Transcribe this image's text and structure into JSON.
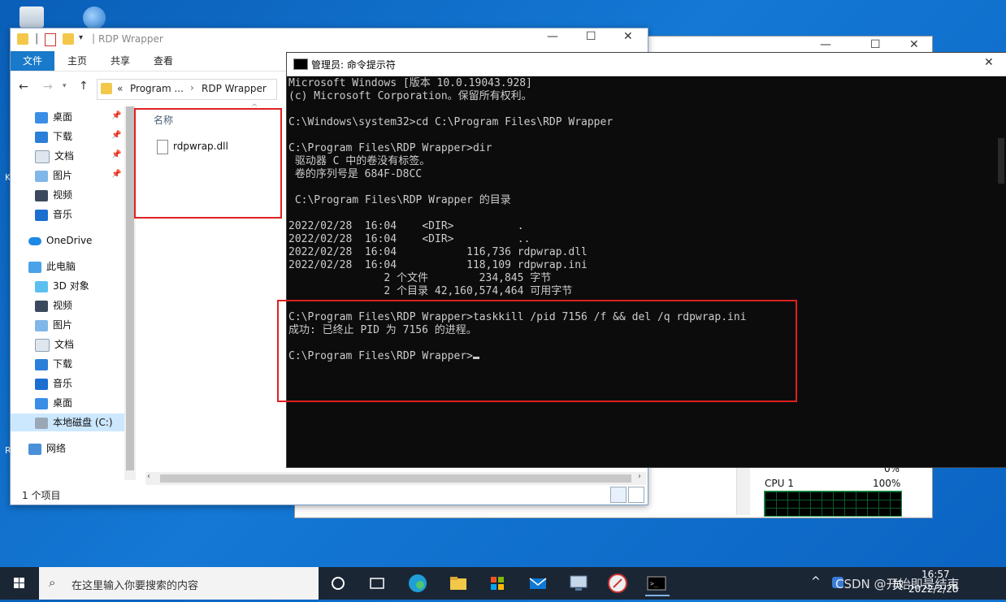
{
  "desktop": {
    "icons": [
      {
        "name": "recycle-bin"
      },
      {
        "name": "network-globe"
      }
    ],
    "side_letters": [
      "K",
      "R"
    ]
  },
  "explorer": {
    "title": "RDP Wrapper",
    "ribbon_tabs": [
      "文件",
      "主页",
      "共享",
      "查看"
    ],
    "breadcrumb": {
      "prefix": "«",
      "items": [
        "Program ...",
        "RDP Wrapper"
      ]
    },
    "nav_quick": [
      {
        "label": "桌面",
        "icon": "desktop-icon"
      },
      {
        "label": "下载",
        "icon": "download-icon"
      },
      {
        "label": "文档",
        "icon": "documents-icon"
      },
      {
        "label": "图片",
        "icon": "pictures-icon"
      },
      {
        "label": "视频",
        "icon": "video-icon"
      },
      {
        "label": "音乐",
        "icon": "music-icon"
      }
    ],
    "onedrive": "OneDrive",
    "this_pc": "此电脑",
    "nav_pc": [
      {
        "label": "3D 对象",
        "icon": "3d-objects-icon"
      },
      {
        "label": "视频",
        "icon": "video-icon"
      },
      {
        "label": "图片",
        "icon": "pictures-icon"
      },
      {
        "label": "文档",
        "icon": "documents-icon"
      },
      {
        "label": "下载",
        "icon": "download-icon"
      },
      {
        "label": "音乐",
        "icon": "music-icon"
      },
      {
        "label": "桌面",
        "icon": "desktop-icon"
      },
      {
        "label": "本地磁盘 (C:)",
        "icon": "local-disk-icon"
      }
    ],
    "network": "网络",
    "column_header": "名称",
    "files": [
      "rdpwrap.dll"
    ],
    "status": "1 个项目"
  },
  "cmd": {
    "title": "管理员: 命令提示符",
    "lines": [
      "Microsoft Windows [版本 10.0.19043.928]",
      "(c) Microsoft Corporation。保留所有权利。",
      "",
      "C:\\Windows\\system32>cd C:\\Program Files\\RDP Wrapper",
      "",
      "C:\\Program Files\\RDP Wrapper>dir",
      " 驱动器 C 中的卷没有标签。",
      " 卷的序列号是 684F-D8CC",
      "",
      " C:\\Program Files\\RDP Wrapper 的目录",
      "",
      "2022/02/28  16:04    <DIR>          .",
      "2022/02/28  16:04    <DIR>          ..",
      "2022/02/28  16:04           116,736 rdpwrap.dll",
      "2022/02/28  16:04           118,109 rdpwrap.ini",
      "               2 个文件        234,845 字节",
      "               2 个目录 42,160,574,464 可用字节",
      "",
      "C:\\Program Files\\RDP Wrapper>taskkill /pid 7156 /f && del /q rdpwrap.ini",
      "成功: 已终止 PID 为 7156 的进程。",
      "",
      "C:\\Program Files\\RDP Wrapper>"
    ]
  },
  "task_manager": {
    "cpu_label": "CPU 1",
    "cpu_max": "100%",
    "cpu_min": "0%"
  },
  "taskbar": {
    "search_placeholder": "在这里输入你要搜索的内容",
    "time": "16:57",
    "date": "2022/2/28",
    "ime": "英",
    "watermark": "CSDN @开始即是结束"
  },
  "colors": {
    "accent": "#1979ca",
    "highlight_box": "#e02020",
    "console_bg": "#0c0c0c",
    "console_fg": "#cccccc",
    "taskbar": "#1b2635"
  }
}
